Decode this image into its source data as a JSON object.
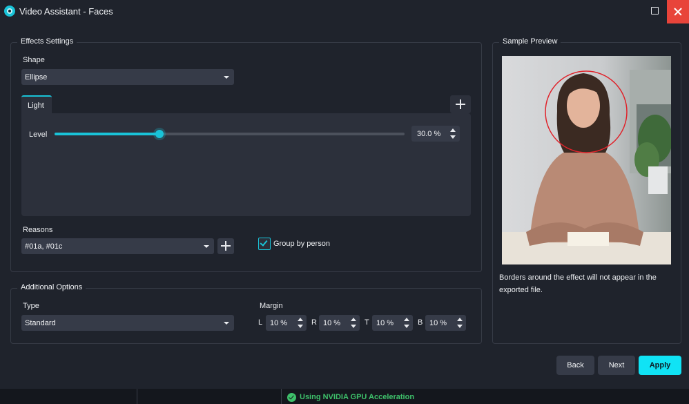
{
  "window": {
    "title": "Video Assistant - Faces",
    "icon": "video-assistant-icon"
  },
  "effects_settings": {
    "title": "Effects Settings",
    "shape_label": "Shape",
    "shape_value": "Ellipse",
    "tabs": [
      {
        "label": "Light",
        "active": true
      }
    ],
    "level_label": "Level",
    "level_value": "30.0 %",
    "level_fraction": 0.3,
    "reasons_label": "Reasons",
    "reasons_value": "#01a, #01c",
    "group_by_person_label": "Group by person",
    "group_by_person_checked": true
  },
  "additional_options": {
    "title": "Additional Options",
    "type_label": "Type",
    "type_value": "Standard",
    "margin_label": "Margin",
    "margins": [
      {
        "side": "L",
        "value": "10 %"
      },
      {
        "side": "R",
        "value": "10 %"
      },
      {
        "side": "T",
        "value": "10 %"
      },
      {
        "side": "B",
        "value": "10 %"
      }
    ]
  },
  "sample_preview": {
    "title": "Sample Preview",
    "note": "Borders around the effect will not appear in the exported file."
  },
  "footer": {
    "back_label": "Back",
    "next_label": "Next",
    "apply_label": "Apply"
  },
  "status": {
    "gpu_text": "Using NVIDIA GPU Acceleration"
  },
  "colors": {
    "accent": "#19c3d8",
    "apply": "#10e3f5",
    "close": "#e8443a",
    "status_ok": "#3ec06a"
  }
}
